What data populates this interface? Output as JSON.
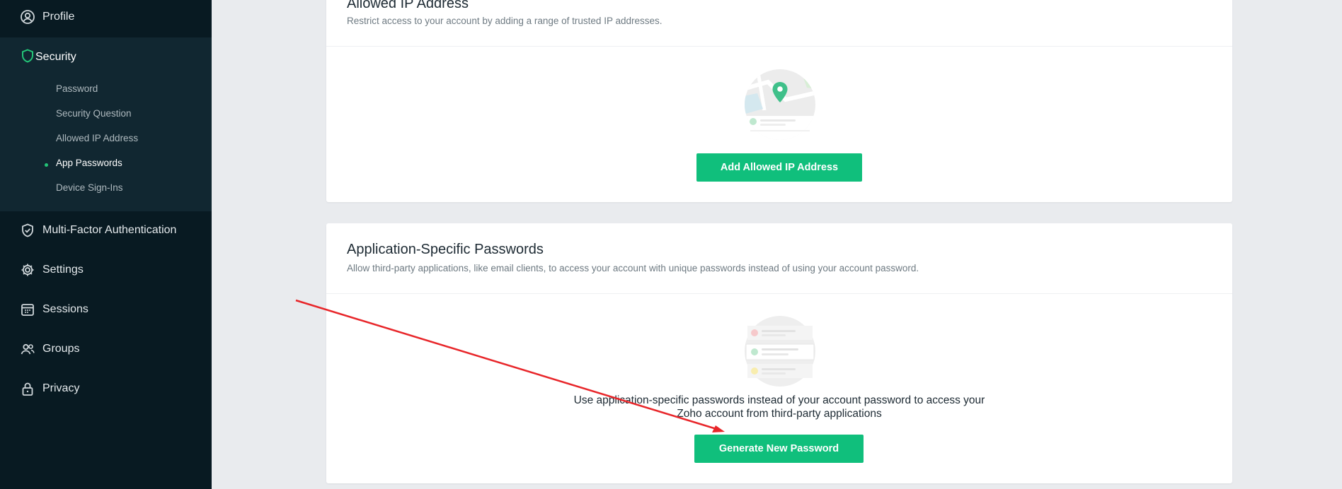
{
  "sidebar": {
    "items": [
      {
        "label": "Profile",
        "icon": "profile-icon"
      },
      {
        "label": "Security",
        "icon": "shield-icon"
      },
      {
        "label": "Multi-Factor Authentication",
        "icon": "shield-check-icon"
      },
      {
        "label": "Settings",
        "icon": "gear-icon"
      },
      {
        "label": "Sessions",
        "icon": "calendar-icon"
      },
      {
        "label": "Groups",
        "icon": "groups-icon"
      },
      {
        "label": "Privacy",
        "icon": "lock-icon"
      }
    ],
    "security_subitems": [
      {
        "label": "Password"
      },
      {
        "label": "Security Question"
      },
      {
        "label": "Allowed IP Address"
      },
      {
        "label": "App Passwords",
        "active": true
      },
      {
        "label": "Device Sign-Ins"
      }
    ]
  },
  "allowed_ip": {
    "title": "Allowed IP Address",
    "description": "Restrict access to your account by adding a range of trusted IP addresses.",
    "button_label": "Add Allowed IP Address"
  },
  "app_passwords": {
    "title": "Application-Specific Passwords",
    "description": "Allow third-party applications, like email clients, to access your account with unique passwords instead of using your account password.",
    "empty_text_line1": "Use application-specific passwords instead of your account password to access your",
    "empty_text_line2": "Zoho account from third-party applications",
    "button_label": "Generate New Password"
  },
  "colors": {
    "sidebar_bg": "#081a22",
    "security_block_bg": "#112731",
    "accent_green": "#10bf7c",
    "annotation_arrow": "#e8262a"
  }
}
